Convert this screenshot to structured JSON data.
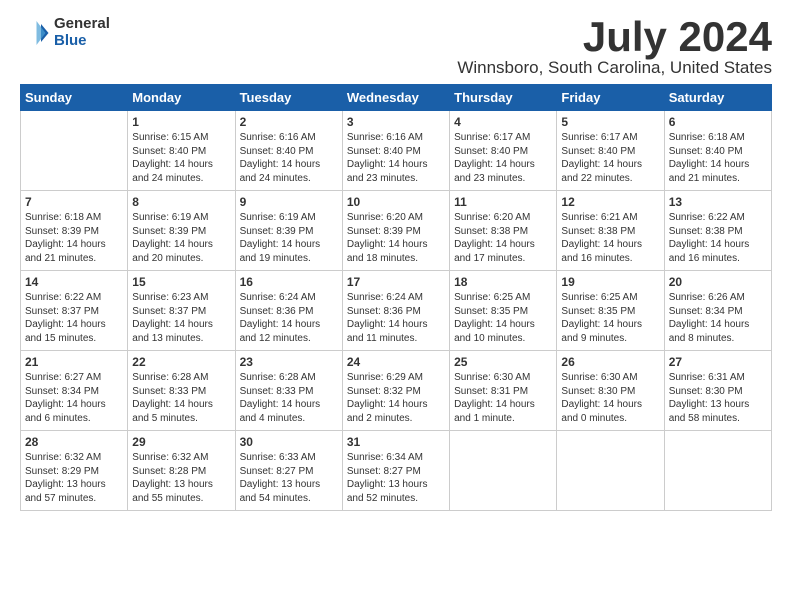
{
  "logo": {
    "general": "General",
    "blue": "Blue"
  },
  "title": "July 2024",
  "subtitle": "Winnsboro, South Carolina, United States",
  "weekdays": [
    "Sunday",
    "Monday",
    "Tuesday",
    "Wednesday",
    "Thursday",
    "Friday",
    "Saturday"
  ],
  "weeks": [
    [
      {
        "day": "",
        "info": ""
      },
      {
        "day": "1",
        "info": "Sunrise: 6:15 AM\nSunset: 8:40 PM\nDaylight: 14 hours\nand 24 minutes."
      },
      {
        "day": "2",
        "info": "Sunrise: 6:16 AM\nSunset: 8:40 PM\nDaylight: 14 hours\nand 24 minutes."
      },
      {
        "day": "3",
        "info": "Sunrise: 6:16 AM\nSunset: 8:40 PM\nDaylight: 14 hours\nand 23 minutes."
      },
      {
        "day": "4",
        "info": "Sunrise: 6:17 AM\nSunset: 8:40 PM\nDaylight: 14 hours\nand 23 minutes."
      },
      {
        "day": "5",
        "info": "Sunrise: 6:17 AM\nSunset: 8:40 PM\nDaylight: 14 hours\nand 22 minutes."
      },
      {
        "day": "6",
        "info": "Sunrise: 6:18 AM\nSunset: 8:40 PM\nDaylight: 14 hours\nand 21 minutes."
      }
    ],
    [
      {
        "day": "7",
        "info": "Sunrise: 6:18 AM\nSunset: 8:39 PM\nDaylight: 14 hours\nand 21 minutes."
      },
      {
        "day": "8",
        "info": "Sunrise: 6:19 AM\nSunset: 8:39 PM\nDaylight: 14 hours\nand 20 minutes."
      },
      {
        "day": "9",
        "info": "Sunrise: 6:19 AM\nSunset: 8:39 PM\nDaylight: 14 hours\nand 19 minutes."
      },
      {
        "day": "10",
        "info": "Sunrise: 6:20 AM\nSunset: 8:39 PM\nDaylight: 14 hours\nand 18 minutes."
      },
      {
        "day": "11",
        "info": "Sunrise: 6:20 AM\nSunset: 8:38 PM\nDaylight: 14 hours\nand 17 minutes."
      },
      {
        "day": "12",
        "info": "Sunrise: 6:21 AM\nSunset: 8:38 PM\nDaylight: 14 hours\nand 16 minutes."
      },
      {
        "day": "13",
        "info": "Sunrise: 6:22 AM\nSunset: 8:38 PM\nDaylight: 14 hours\nand 16 minutes."
      }
    ],
    [
      {
        "day": "14",
        "info": "Sunrise: 6:22 AM\nSunset: 8:37 PM\nDaylight: 14 hours\nand 15 minutes."
      },
      {
        "day": "15",
        "info": "Sunrise: 6:23 AM\nSunset: 8:37 PM\nDaylight: 14 hours\nand 13 minutes."
      },
      {
        "day": "16",
        "info": "Sunrise: 6:24 AM\nSunset: 8:36 PM\nDaylight: 14 hours\nand 12 minutes."
      },
      {
        "day": "17",
        "info": "Sunrise: 6:24 AM\nSunset: 8:36 PM\nDaylight: 14 hours\nand 11 minutes."
      },
      {
        "day": "18",
        "info": "Sunrise: 6:25 AM\nSunset: 8:35 PM\nDaylight: 14 hours\nand 10 minutes."
      },
      {
        "day": "19",
        "info": "Sunrise: 6:25 AM\nSunset: 8:35 PM\nDaylight: 14 hours\nand 9 minutes."
      },
      {
        "day": "20",
        "info": "Sunrise: 6:26 AM\nSunset: 8:34 PM\nDaylight: 14 hours\nand 8 minutes."
      }
    ],
    [
      {
        "day": "21",
        "info": "Sunrise: 6:27 AM\nSunset: 8:34 PM\nDaylight: 14 hours\nand 6 minutes."
      },
      {
        "day": "22",
        "info": "Sunrise: 6:28 AM\nSunset: 8:33 PM\nDaylight: 14 hours\nand 5 minutes."
      },
      {
        "day": "23",
        "info": "Sunrise: 6:28 AM\nSunset: 8:33 PM\nDaylight: 14 hours\nand 4 minutes."
      },
      {
        "day": "24",
        "info": "Sunrise: 6:29 AM\nSunset: 8:32 PM\nDaylight: 14 hours\nand 2 minutes."
      },
      {
        "day": "25",
        "info": "Sunrise: 6:30 AM\nSunset: 8:31 PM\nDaylight: 14 hours\nand 1 minute."
      },
      {
        "day": "26",
        "info": "Sunrise: 6:30 AM\nSunset: 8:30 PM\nDaylight: 14 hours\nand 0 minutes."
      },
      {
        "day": "27",
        "info": "Sunrise: 6:31 AM\nSunset: 8:30 PM\nDaylight: 13 hours\nand 58 minutes."
      }
    ],
    [
      {
        "day": "28",
        "info": "Sunrise: 6:32 AM\nSunset: 8:29 PM\nDaylight: 13 hours\nand 57 minutes."
      },
      {
        "day": "29",
        "info": "Sunrise: 6:32 AM\nSunset: 8:28 PM\nDaylight: 13 hours\nand 55 minutes."
      },
      {
        "day": "30",
        "info": "Sunrise: 6:33 AM\nSunset: 8:27 PM\nDaylight: 13 hours\nand 54 minutes."
      },
      {
        "day": "31",
        "info": "Sunrise: 6:34 AM\nSunset: 8:27 PM\nDaylight: 13 hours\nand 52 minutes."
      },
      {
        "day": "",
        "info": ""
      },
      {
        "day": "",
        "info": ""
      },
      {
        "day": "",
        "info": ""
      }
    ]
  ]
}
